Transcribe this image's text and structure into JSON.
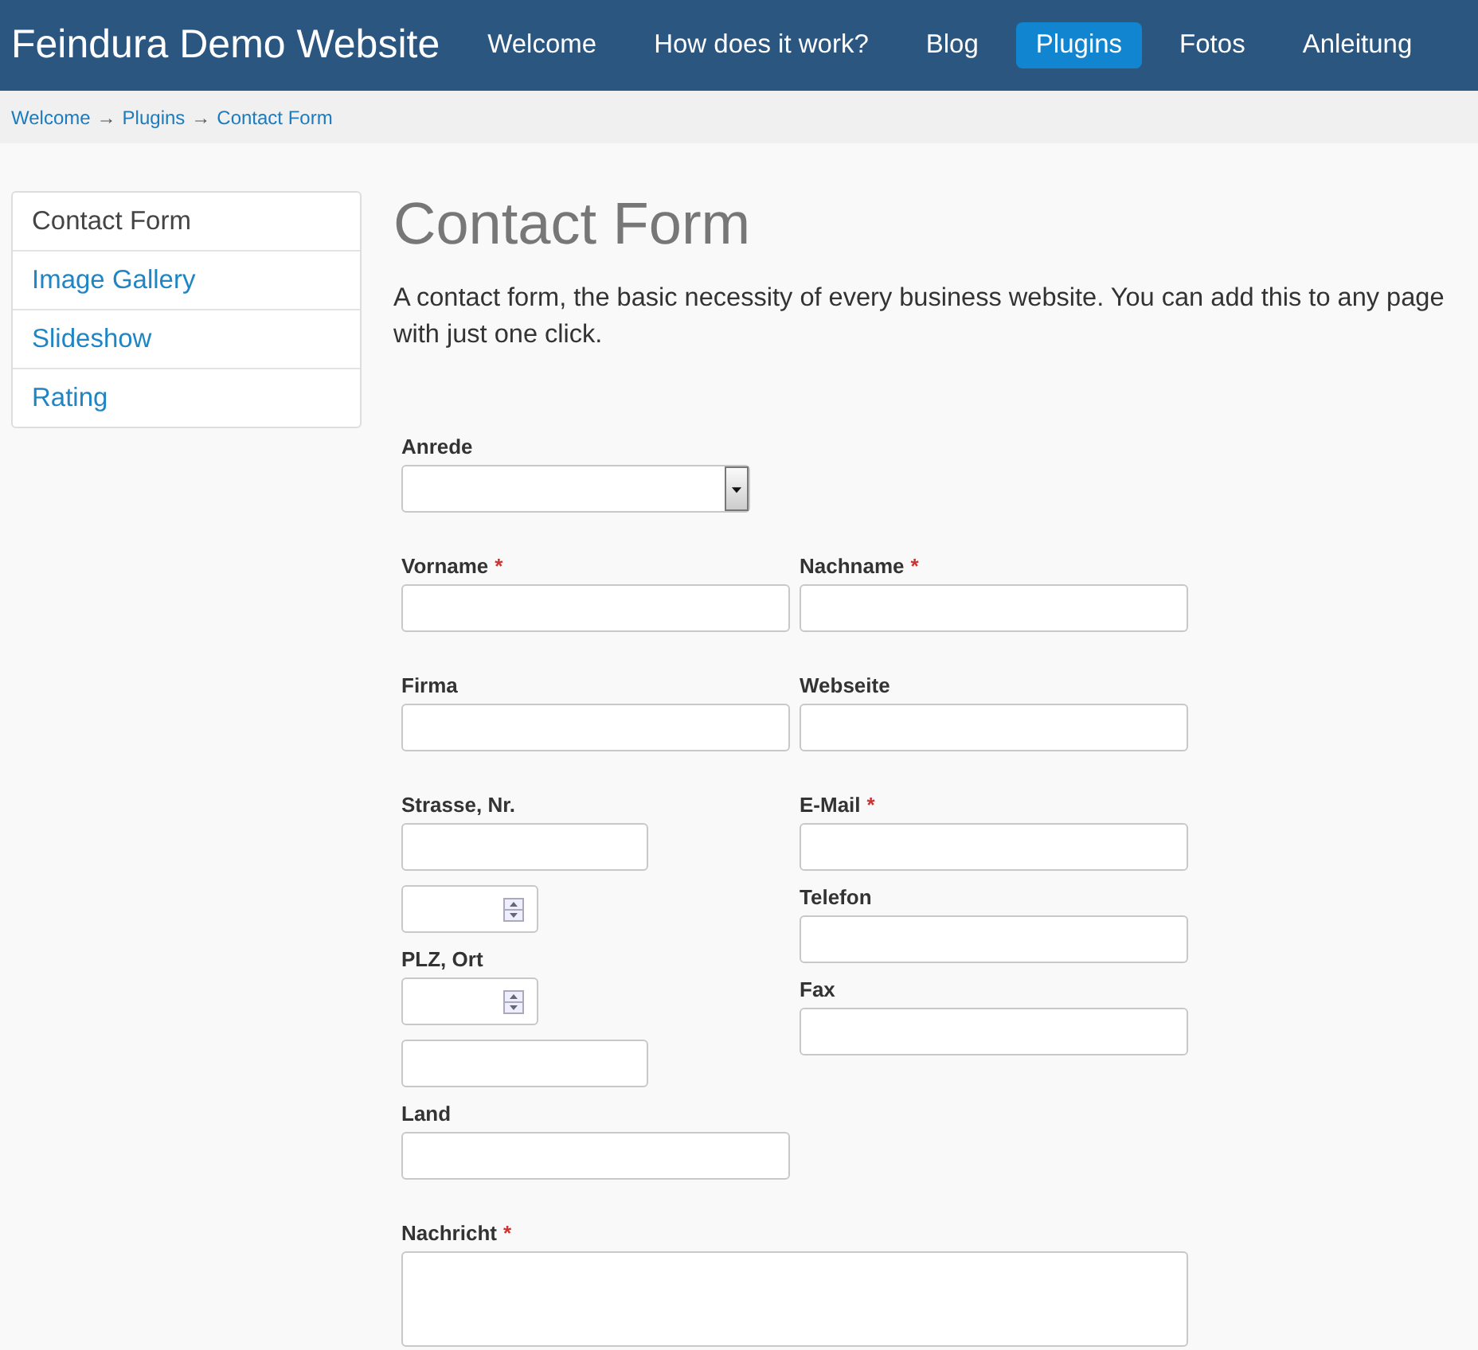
{
  "header": {
    "site_title": "Feindura Demo Website",
    "nav": [
      {
        "label": "Welcome",
        "selected": false
      },
      {
        "label": "How does it work?",
        "selected": false
      },
      {
        "label": "Blog",
        "selected": false
      },
      {
        "label": "Plugins",
        "selected": true
      },
      {
        "label": "Fotos",
        "selected": false
      },
      {
        "label": "Anleitung",
        "selected": false
      }
    ]
  },
  "breadcrumb": {
    "items": [
      "Welcome",
      "Plugins",
      "Contact Form"
    ],
    "separator": "→"
  },
  "sidebar": {
    "items": [
      {
        "label": "Contact Form",
        "selected": true
      },
      {
        "label": "Image Gallery",
        "selected": false
      },
      {
        "label": "Slideshow",
        "selected": false
      },
      {
        "label": "Rating",
        "selected": false
      }
    ]
  },
  "content": {
    "title": "Contact Form",
    "intro": "A contact form, the basic necessity of every business website. You can add this to any page with just one click."
  },
  "form": {
    "rows": [
      {
        "columns": [
          [
            {
              "kind": "select",
              "label": "Anrede"
            }
          ],
          []
        ]
      },
      {
        "columns": [
          [
            {
              "kind": "text",
              "label": "Vorname",
              "required_mark": "*"
            }
          ],
          [
            {
              "kind": "text",
              "label": "Nachname",
              "required_mark": "*"
            }
          ]
        ]
      },
      {
        "columns": [
          [
            {
              "kind": "text",
              "label": "Firma"
            }
          ],
          [
            {
              "kind": "text",
              "label": "Webseite"
            }
          ]
        ]
      },
      {
        "columns": [
          [
            {
              "kind": "short-text",
              "label": "Strasse, Nr."
            },
            {
              "kind": "spinner"
            },
            {
              "kind": "spinner",
              "label": "PLZ, Ort"
            },
            {
              "kind": "short-text"
            },
            {
              "kind": "text",
              "label": "Land"
            }
          ],
          [
            {
              "kind": "text",
              "label": "E-Mail",
              "required_mark": "*"
            },
            {
              "kind": "text",
              "label": "Telefon"
            },
            {
              "kind": "text",
              "label": "Fax"
            }
          ]
        ]
      },
      {
        "columns": [
          [
            {
              "kind": "textarea",
              "label": "Nachricht",
              "required_mark": "*"
            }
          ]
        ]
      }
    ]
  }
}
